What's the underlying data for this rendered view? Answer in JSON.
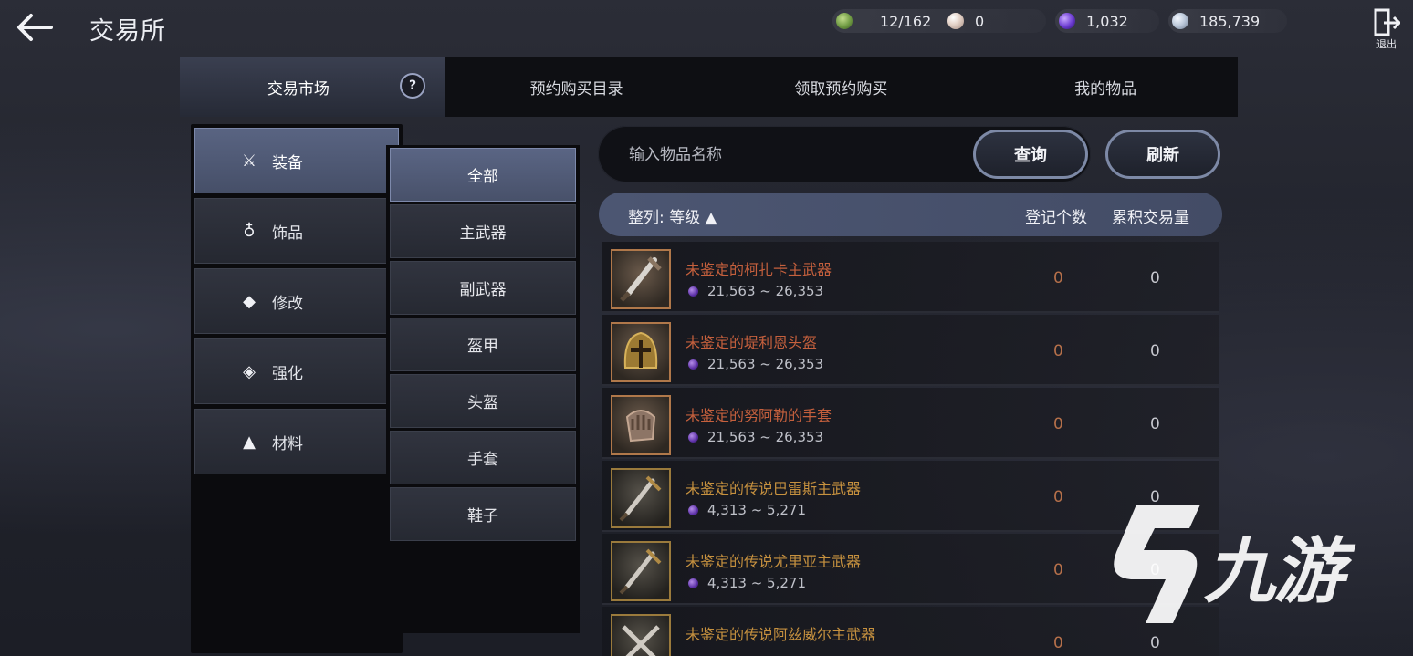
{
  "header": {
    "title": "交易所",
    "exit_label": "退出"
  },
  "currencies": [
    {
      "name": "capacity",
      "icon": "green-bag-icon",
      "value": "12/162",
      "color": "#7aa35a"
    },
    {
      "name": "pearl",
      "icon": "pearl-icon",
      "value": "0",
      "color": "#d9c7bd"
    },
    {
      "name": "purple-crystal",
      "icon": "purple-crystal-icon",
      "value": "1,032",
      "color": "#6a3ad0"
    },
    {
      "name": "silver",
      "icon": "silver-coin-icon",
      "value": "185,739",
      "color": "#b9c6d8"
    }
  ],
  "tabs": [
    {
      "label": "交易市场",
      "active": true
    },
    {
      "label": "预约购买目录",
      "active": false
    },
    {
      "label": "领取预约购买",
      "active": false
    },
    {
      "label": "我的物品",
      "active": false
    }
  ],
  "categories": [
    {
      "label": "装备",
      "icon": "crossed-swords-icon",
      "active": true
    },
    {
      "label": "饰品",
      "icon": "medal-icon",
      "active": false
    },
    {
      "label": "修改",
      "icon": "gem-icon",
      "active": false
    },
    {
      "label": "强化",
      "icon": "enhance-icon",
      "active": false
    },
    {
      "label": "材料",
      "icon": "potion-icon",
      "active": false
    }
  ],
  "subcategories": [
    {
      "label": "全部",
      "active": true
    },
    {
      "label": "主武器",
      "active": false
    },
    {
      "label": "副武器",
      "active": false
    },
    {
      "label": "盔甲",
      "active": false
    },
    {
      "label": "头盔",
      "active": false
    },
    {
      "label": "手套",
      "active": false
    },
    {
      "label": "鞋子",
      "active": false
    }
  ],
  "search": {
    "placeholder": "输入物品名称",
    "query_label": "查询",
    "refresh_label": "刷新"
  },
  "list_header": {
    "sort_label": "整列: 等级 ▲",
    "col_registered": "登记个数",
    "col_volume": "累积交易量"
  },
  "items": [
    {
      "name": "未鉴定的柯扎卡主武器",
      "price": "21,563 ~ 26,353",
      "registered": "0",
      "volume": "0",
      "icon": "dagger-icon",
      "rarity": "rare"
    },
    {
      "name": "未鉴定的堤利恩头盔",
      "price": "21,563 ~ 26,353",
      "registered": "0",
      "volume": "0",
      "icon": "helmet-icon",
      "rarity": "rare"
    },
    {
      "name": "未鉴定的努阿勒的手套",
      "price": "21,563 ~ 26,353",
      "registered": "0",
      "volume": "0",
      "icon": "gauntlet-icon",
      "rarity": "rare"
    },
    {
      "name": "未鉴定的传说巴雷斯主武器",
      "price": "4,313 ~ 5,271",
      "registered": "0",
      "volume": "0",
      "icon": "dagger-icon",
      "rarity": "legend"
    },
    {
      "name": "未鉴定的传说尤里亚主武器",
      "price": "4,313 ~ 5,271",
      "registered": "0",
      "volume": "0",
      "icon": "dagger-icon",
      "rarity": "legend"
    },
    {
      "name": "未鉴定的传说阿兹威尔主武器",
      "price": "",
      "registered": "0",
      "volume": "0",
      "icon": "crossed-blades-icon",
      "rarity": "legend"
    }
  ],
  "watermark": {
    "text": "九游"
  }
}
